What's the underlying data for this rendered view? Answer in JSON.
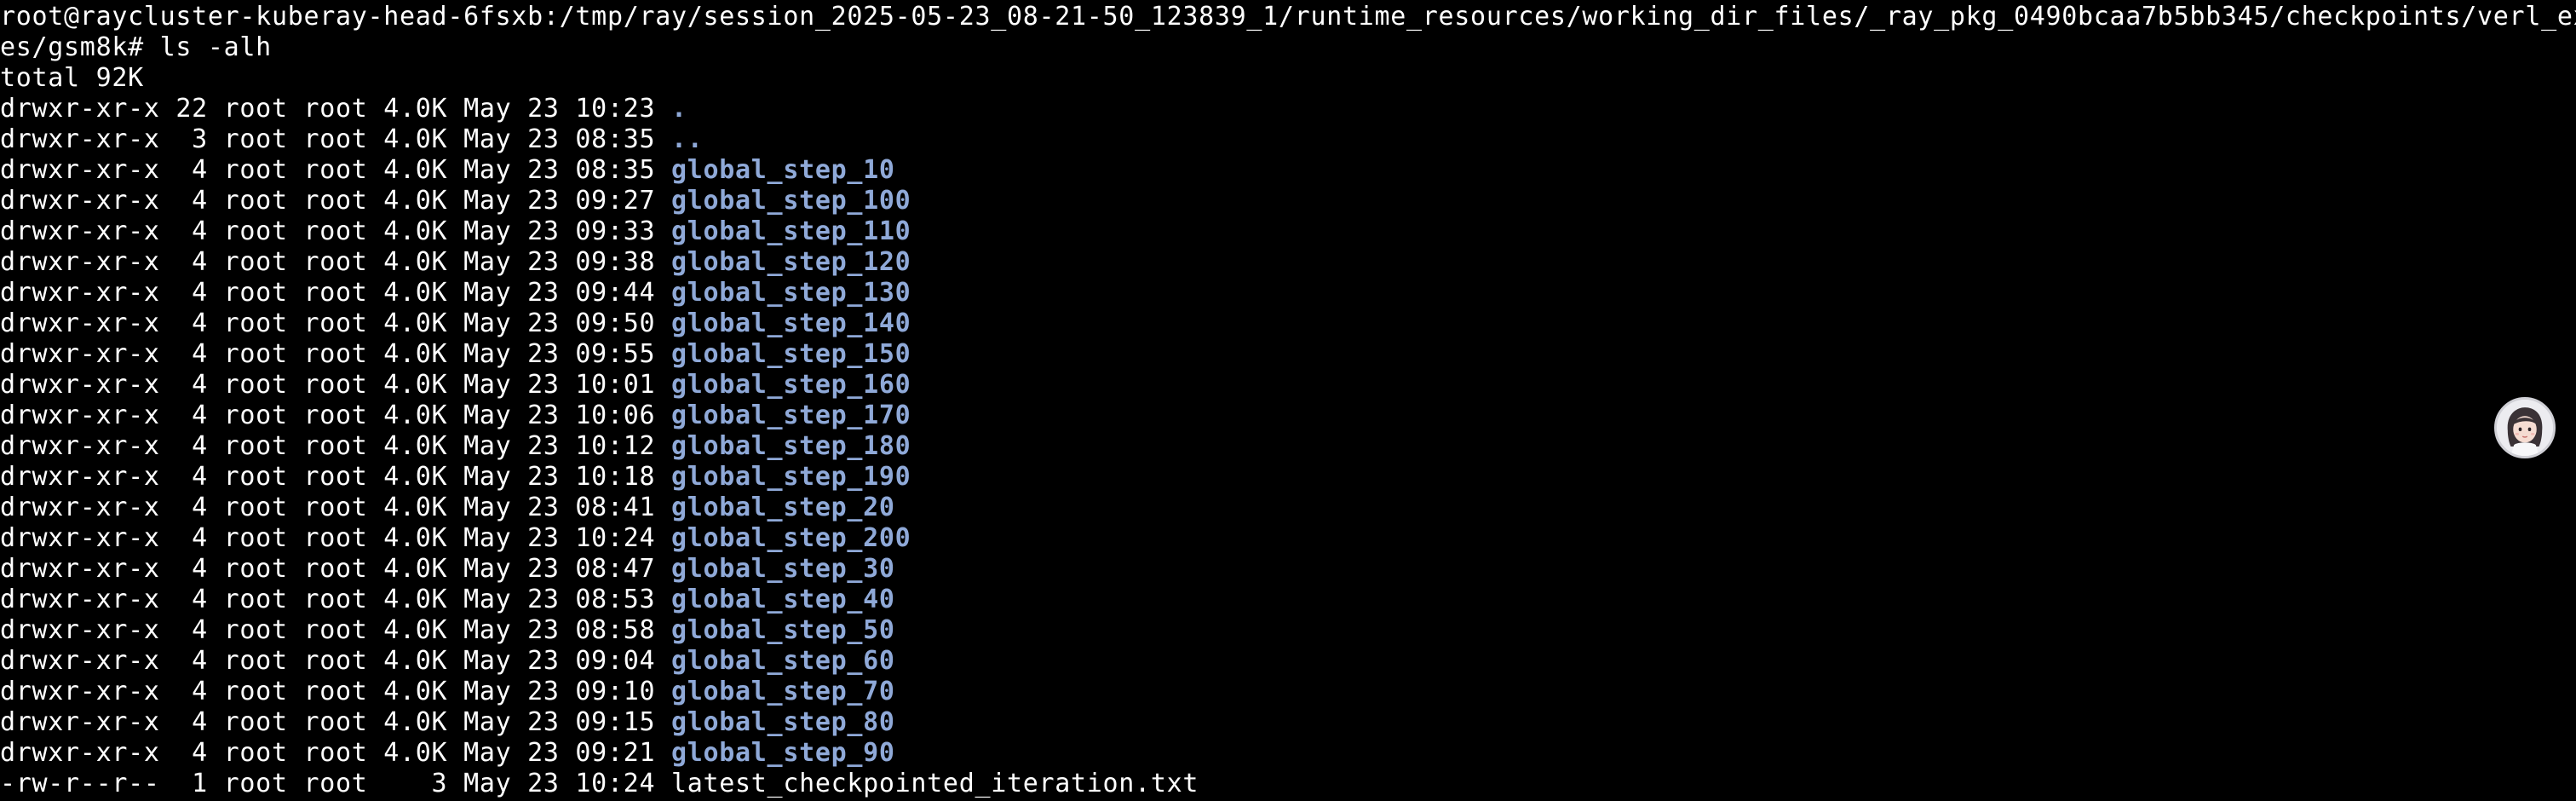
{
  "prompt": {
    "line1": "root@raycluster-kuberay-head-6fsxb:/tmp/ray/session_2025-05-23_08-21-50_123839_1/runtime_resources/working_dir_files/_ray_pkg_0490bcaa7b5bb345/checkpoints/verl_exampl",
    "line2": "es/gsm8k# ls -alh"
  },
  "total": "total 92K",
  "entries": [
    {
      "meta": "drwxr-xr-x 22 root root 4.0K May 23 10:23 ",
      "name": "."
    },
    {
      "meta": "drwxr-xr-x  3 root root 4.0K May 23 08:35 ",
      "name": ".."
    },
    {
      "meta": "drwxr-xr-x  4 root root 4.0K May 23 08:35 ",
      "name": "global_step_10"
    },
    {
      "meta": "drwxr-xr-x  4 root root 4.0K May 23 09:27 ",
      "name": "global_step_100"
    },
    {
      "meta": "drwxr-xr-x  4 root root 4.0K May 23 09:33 ",
      "name": "global_step_110"
    },
    {
      "meta": "drwxr-xr-x  4 root root 4.0K May 23 09:38 ",
      "name": "global_step_120"
    },
    {
      "meta": "drwxr-xr-x  4 root root 4.0K May 23 09:44 ",
      "name": "global_step_130"
    },
    {
      "meta": "drwxr-xr-x  4 root root 4.0K May 23 09:50 ",
      "name": "global_step_140"
    },
    {
      "meta": "drwxr-xr-x  4 root root 4.0K May 23 09:55 ",
      "name": "global_step_150"
    },
    {
      "meta": "drwxr-xr-x  4 root root 4.0K May 23 10:01 ",
      "name": "global_step_160"
    },
    {
      "meta": "drwxr-xr-x  4 root root 4.0K May 23 10:06 ",
      "name": "global_step_170"
    },
    {
      "meta": "drwxr-xr-x  4 root root 4.0K May 23 10:12 ",
      "name": "global_step_180"
    },
    {
      "meta": "drwxr-xr-x  4 root root 4.0K May 23 10:18 ",
      "name": "global_step_190"
    },
    {
      "meta": "drwxr-xr-x  4 root root 4.0K May 23 08:41 ",
      "name": "global_step_20"
    },
    {
      "meta": "drwxr-xr-x  4 root root 4.0K May 23 10:24 ",
      "name": "global_step_200"
    },
    {
      "meta": "drwxr-xr-x  4 root root 4.0K May 23 08:47 ",
      "name": "global_step_30"
    },
    {
      "meta": "drwxr-xr-x  4 root root 4.0K May 23 08:53 ",
      "name": "global_step_40"
    },
    {
      "meta": "drwxr-xr-x  4 root root 4.0K May 23 08:58 ",
      "name": "global_step_50"
    },
    {
      "meta": "drwxr-xr-x  4 root root 4.0K May 23 09:04 ",
      "name": "global_step_60"
    },
    {
      "meta": "drwxr-xr-x  4 root root 4.0K May 23 09:10 ",
      "name": "global_step_70"
    },
    {
      "meta": "drwxr-xr-x  4 root root 4.0K May 23 09:15 ",
      "name": "global_step_80"
    },
    {
      "meta": "drwxr-xr-x  4 root root 4.0K May 23 09:21 ",
      "name": "global_step_90"
    },
    {
      "meta": "-rw-r--r--  1 root root    3 May 23 10:24 ",
      "name": "latest_checkpointed_iteration.txt"
    }
  ],
  "colors": {
    "background": "#000000",
    "text": "#ffffff",
    "directory": "#8fa9d8"
  },
  "avatar": {
    "icon": "user-avatar-icon"
  }
}
